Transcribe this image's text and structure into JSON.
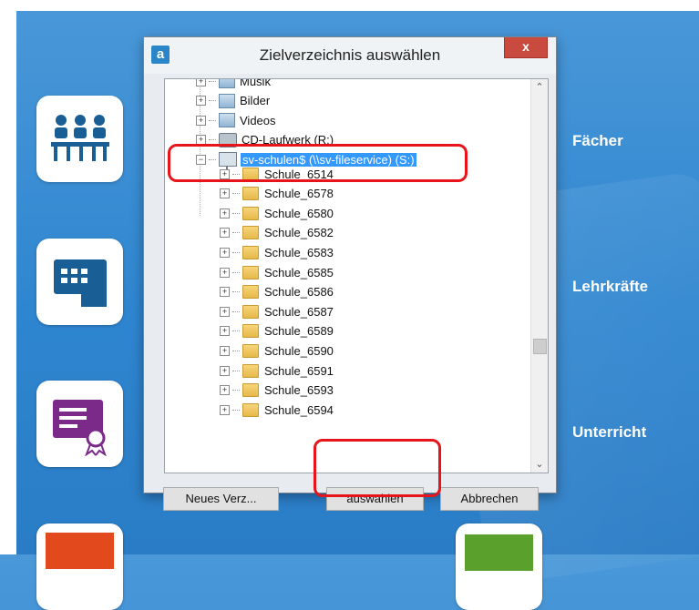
{
  "dialog": {
    "title": "Zielverzeichnis auswählen",
    "app_icon_letter": "a",
    "close_label": "x"
  },
  "tree": {
    "items": [
      {
        "label": "Musik",
        "icon": "music-library-icon"
      },
      {
        "label": "Bilder",
        "icon": "pictures-library-icon"
      },
      {
        "label": "Videos",
        "icon": "videos-library-icon"
      },
      {
        "label": "CD-Laufwerk (R:)",
        "icon": "cd-drive-icon"
      },
      {
        "label": "sv-schulen$ (\\\\sv-fileservice) (S:)",
        "icon": "network-drive-icon",
        "selected": true
      }
    ],
    "folders": [
      "Schule_6514",
      "Schule_6578",
      "Schule_6580",
      "Schule_6582",
      "Schule_6583",
      "Schule_6585",
      "Schule_6586",
      "Schule_6587",
      "Schule_6589",
      "Schule_6590",
      "Schule_6591",
      "Schule_6593",
      "Schule_6594"
    ]
  },
  "buttons": {
    "new_folder": "Neues Verz...",
    "select": "auswählen",
    "cancel": "Abbrechen"
  },
  "side_labels": {
    "subjects": "Fächer",
    "teachers": "Lehrkräfte",
    "lessons": "Unterricht"
  },
  "colors": {
    "background": "#2f86d0",
    "highlight": "#e8141b",
    "selection": "#3399ff",
    "tile_icon_blue": "#1a5e96",
    "tile_icon_purple": "#7b2a8a"
  }
}
